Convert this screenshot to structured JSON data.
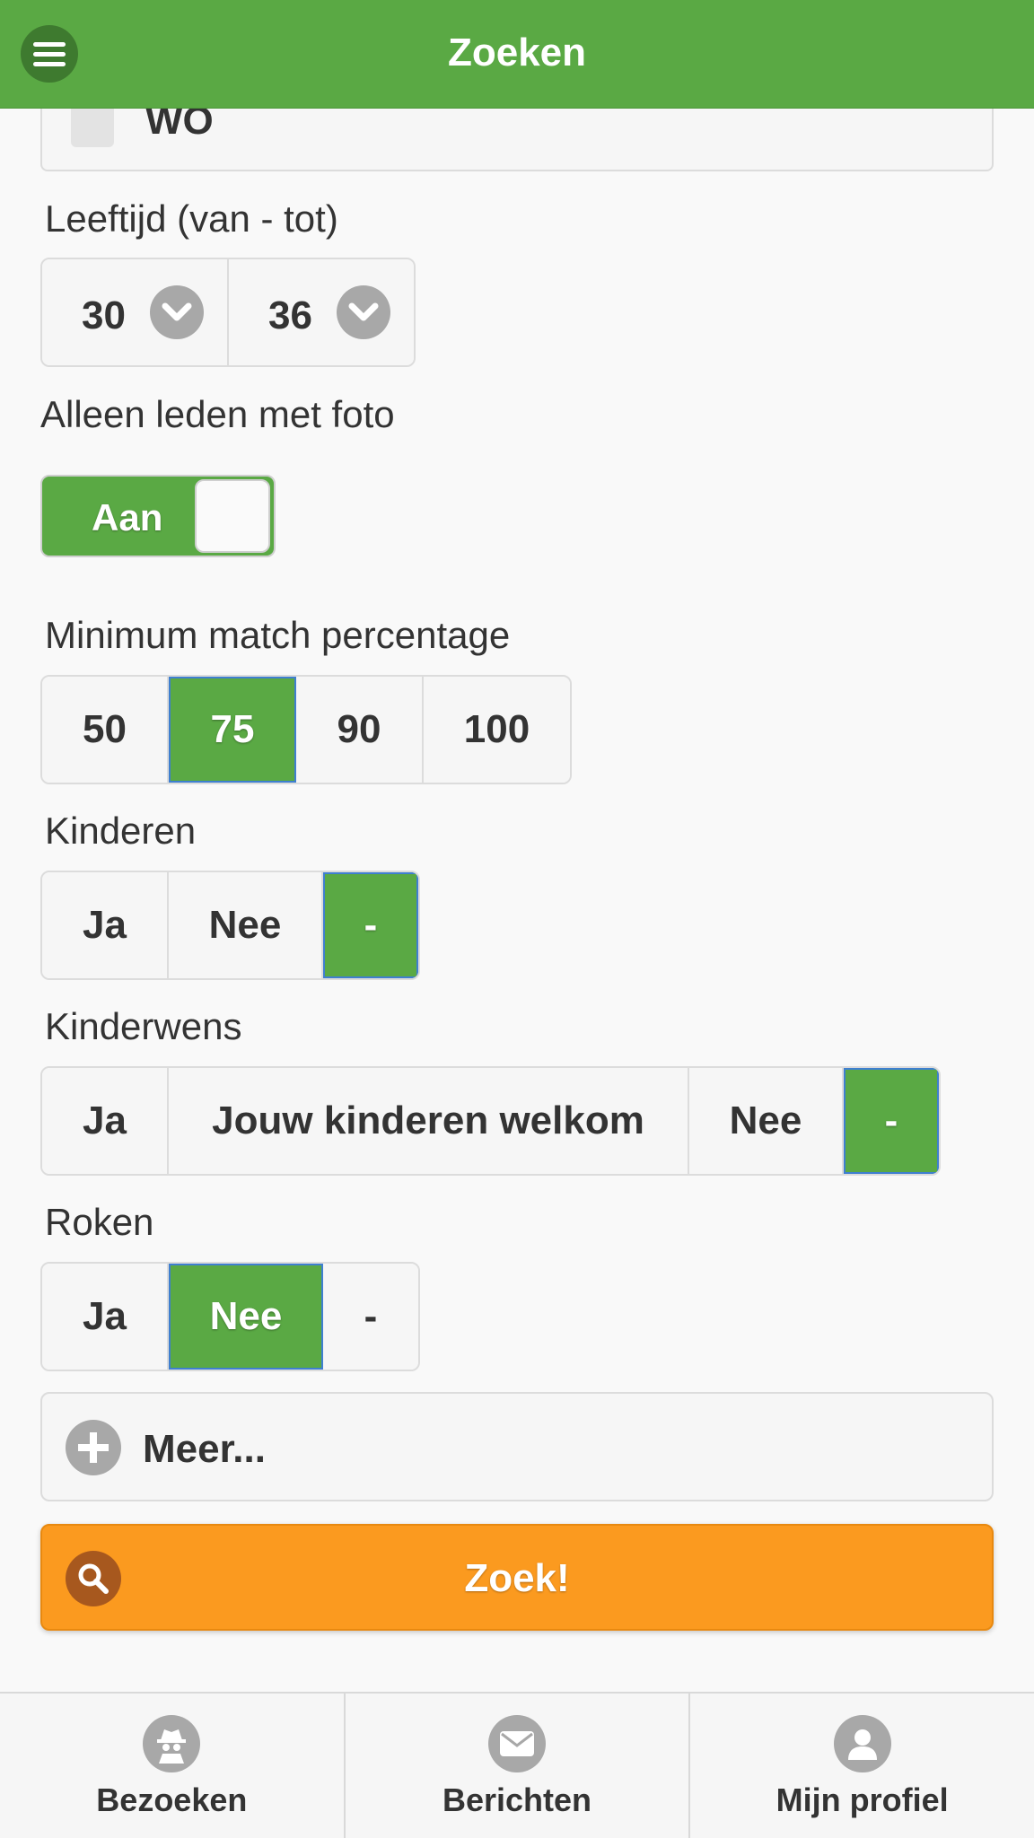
{
  "header": {
    "title": "Zoeken"
  },
  "education": {
    "partial_option_label": "WO"
  },
  "age": {
    "label": "Leeftijd (van - tot)",
    "from": "30",
    "to": "36"
  },
  "photo_only": {
    "label": "Alleen leden met foto",
    "toggle_label": "Aan",
    "value": true
  },
  "match": {
    "label": "Minimum match percentage",
    "options": [
      "50",
      "75",
      "90",
      "100"
    ],
    "selected": "75"
  },
  "children": {
    "label": "Kinderen",
    "options": [
      "Ja",
      "Nee",
      "-"
    ],
    "selected": "-"
  },
  "children_wish": {
    "label": "Kinderwens",
    "options": [
      "Ja",
      "Jouw kinderen welkom",
      "Nee",
      "-"
    ],
    "selected": "-"
  },
  "smoking": {
    "label": "Roken",
    "options": [
      "Ja",
      "Nee",
      "-"
    ],
    "selected": "Nee"
  },
  "more": {
    "label": "Meer..."
  },
  "search_button": {
    "label": "Zoek!"
  },
  "footer": {
    "tabs": [
      {
        "label": "Bezoeken",
        "icon": "spy-icon"
      },
      {
        "label": "Berichten",
        "icon": "envelope-icon"
      },
      {
        "label": "Mijn profiel",
        "icon": "user-icon"
      }
    ]
  },
  "colors": {
    "header": "#5aa944",
    "active": "#5aa944",
    "active_border": "#3f7fd0",
    "search": "#fb9a1f"
  }
}
